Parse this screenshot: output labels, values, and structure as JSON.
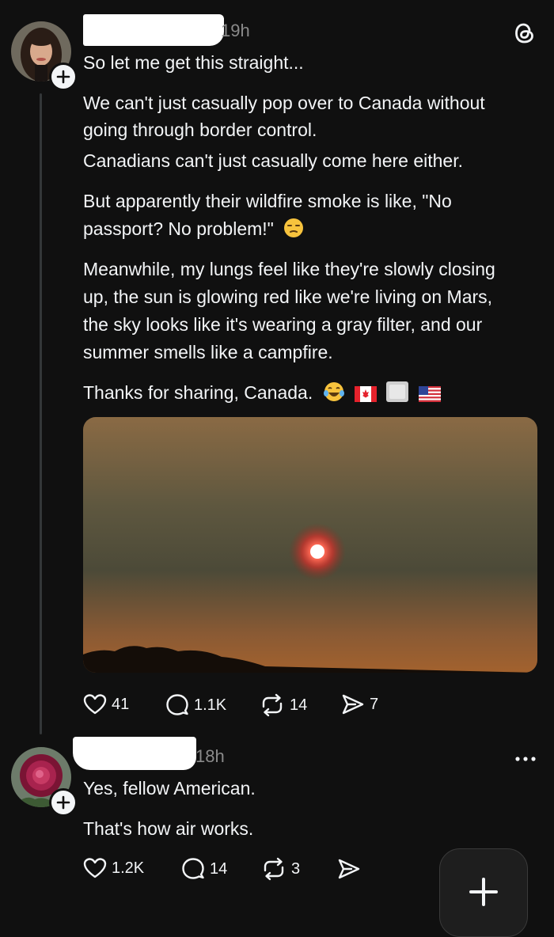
{
  "post": {
    "timestamp": "19h",
    "paragraphs": {
      "p1": "So let me get this straight...",
      "p2a": "We can't just casually pop over to Canada without",
      "p2b": "going through border control.",
      "p3": "Canadians can't just casually come here either.",
      "p4a": "But apparently their wildfire smoke is like, \"No",
      "p4b": "passport? No problem!\"",
      "p5a": "Meanwhile, my lungs feel like they're slowly closing",
      "p5b": "up, the sun is glowing red like we're living on Mars,",
      "p5c": "the sky looks like it's wearing a gray filter, and our",
      "p5d": "summer smells like a campfire.",
      "p6": "Thanks for sharing, Canada."
    },
    "actions": {
      "likes": "41",
      "replies": "1.1K",
      "reposts": "14",
      "shares": "7"
    }
  },
  "reply": {
    "timestamp": "18h",
    "paragraphs": {
      "p1": "Yes, fellow American.",
      "p2": "That's how air works."
    },
    "actions": {
      "likes": "1.2K",
      "replies": "14",
      "reposts": "3"
    }
  },
  "icons": {
    "app": "threads-logo-icon",
    "like": "heart-icon",
    "reply": "comment-icon",
    "repost": "repost-icon",
    "share": "send-icon",
    "more": "more-icon",
    "follow": "plus-icon",
    "compose": "plus-icon"
  },
  "colors": {
    "background": "#101010",
    "text": "#f3f5f7",
    "secondary_text": "#8a8a8a",
    "thread_line": "#333638"
  }
}
